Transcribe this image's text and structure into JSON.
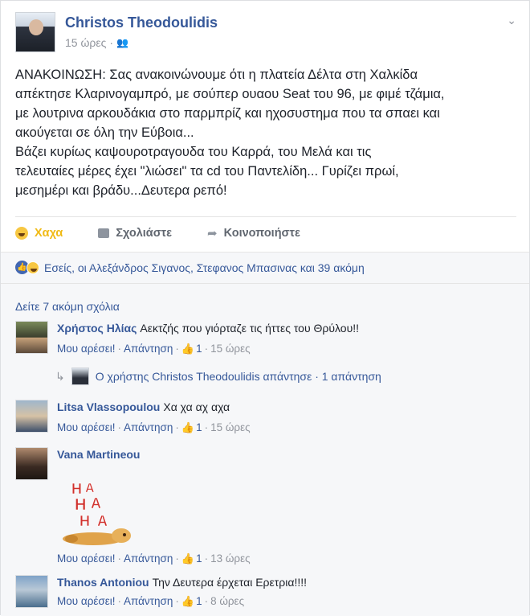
{
  "post": {
    "author": "Christos Theodoulidis",
    "time": "15 ώρες",
    "audience_icon": "friends-icon",
    "menu_icon": "chevron-down-icon",
    "lines": [
      "ΑΝΑΚΟΙΝΩΣΗ: Σας ανακοινώνουμε ότι η πλατεία Δέλτα στη Χαλκίδα",
      "απέκτησε Κλαρινογαμπρό, με σούπερ ουαου Seat του 96, με φιμέ τζάμια,",
      "με λουτρινα αρκουδάκια στο παρμπρίζ και ηχοσυστημα που τα σπαει και",
      "ακούγεται σε όλη την Εύβοια...",
      "Βάζει κυρίως καψουροτραγουδα του Καρρά, του Μελά και τις",
      "τελευταίες μέρες έχει \"λιώσει\" τα cd του Παντελίδη... Γυρίζει πρωί,",
      "μεσημέρι και βράδυ...Δευτερα ρεπό!"
    ]
  },
  "actions": {
    "haha": "Χαχα",
    "comment": "Σχολιάστε",
    "share": "Κοινοποιήστε"
  },
  "reactions": {
    "summary": "Εσείς, οι Αλεξάνδρος Σιγανος, Στεφανος Μπασινας και 39 ακόμη"
  },
  "comments_section": {
    "more_label": "Δείτε 7 ακόμη σχόλια",
    "like_label": "Μου αρέσει!",
    "reply_label": "Απάντηση",
    "comments": [
      {
        "name": "Χρήστος Ηλίας",
        "text": "Αεκτζής που γιόρταζε τις ήττες του Θρύλου!!",
        "likes": "1",
        "time": "15 ώρες"
      },
      {
        "name": "Litsa Vlassopoulou",
        "text": "Χα χα αχ αχα",
        "likes": "1",
        "time": "15 ώρες"
      },
      {
        "name": "Vana Martineou",
        "text": "",
        "likes": "1",
        "time": "13 ώρες"
      },
      {
        "name": "Thanos Antoniou",
        "text": "Την Δευτερα έρχεται Ερετρια!!!!",
        "likes": "1",
        "time": "8 ώρες"
      }
    ],
    "reply_summary": "Ο χρήστης Christos Theodoulidis απάντησε · 1 απάντηση"
  },
  "colors": {
    "link": "#365899",
    "meta": "#90949c",
    "haha": "#f0ba15",
    "like_blue": "#4267b2",
    "background": "#f6f7f9"
  }
}
